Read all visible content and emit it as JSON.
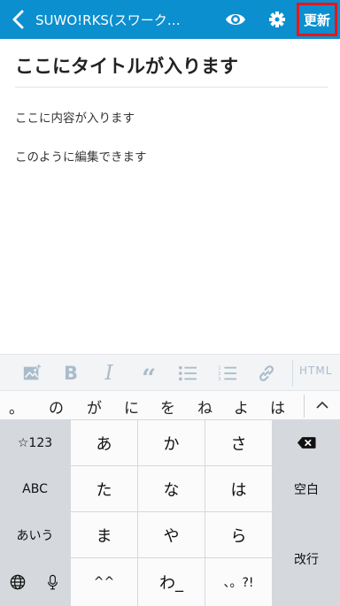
{
  "topbar": {
    "site_title": "SUWO!RKS(スワーク…",
    "update_label": "更新",
    "back_icon": "chevron-left-icon",
    "preview_icon": "eye-icon",
    "settings_icon": "gear-icon",
    "bar_color": "#0b8fcf",
    "highlight_color": "#e8161a"
  },
  "editor": {
    "title": "ここにタイトルが入ります",
    "lines": [
      "ここに内容が入ります",
      "このように編集できます"
    ]
  },
  "format_toolbar": {
    "items": [
      "image-icon",
      "bold-icon",
      "italic-icon",
      "quote-icon",
      "bullet-list-icon",
      "numbered-list-icon",
      "link-icon"
    ],
    "html_label": "HTML"
  },
  "prediction_bar": {
    "candidates": [
      "。",
      "の",
      "が",
      "に",
      "を",
      "ね",
      "よ",
      "は"
    ]
  },
  "keyboard": {
    "row1": {
      "fn": "☆123",
      "keys": [
        "あ",
        "か",
        "さ"
      ]
    },
    "row2": {
      "fn": "ABC",
      "keys": [
        "た",
        "な",
        "は"
      ],
      "right": "空白"
    },
    "row3": {
      "fn": "あいう",
      "keys": [
        "ま",
        "や",
        "ら"
      ],
      "right": "改行"
    },
    "row4": {
      "keys": [
        "^^",
        "わ_",
        "、。?!"
      ]
    }
  }
}
